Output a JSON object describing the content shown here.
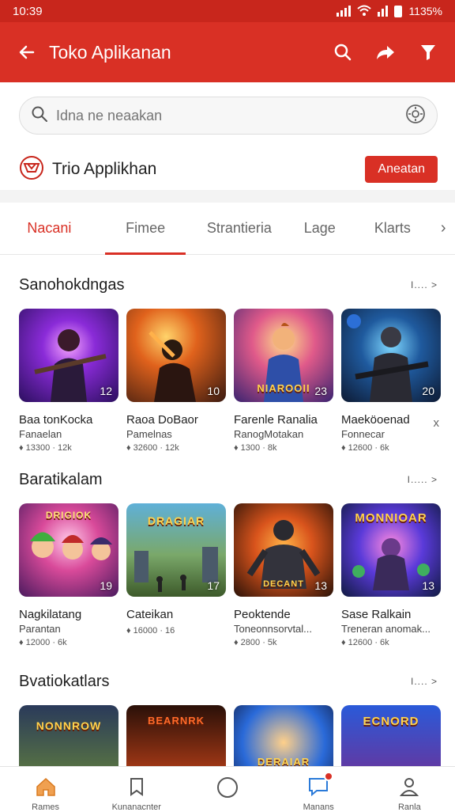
{
  "status": {
    "time": "10:39",
    "battery": "1135%"
  },
  "header": {
    "title": "Toko Aplikanan"
  },
  "search": {
    "placeholder": "Idna ne neaakan"
  },
  "store": {
    "name": "Trio Applikhan",
    "button": "Aneatan"
  },
  "tabs": [
    {
      "label": "Nacani"
    },
    {
      "label": "Fimee"
    },
    {
      "label": "Strantieria"
    },
    {
      "label": "Lage"
    },
    {
      "label": "Klarts"
    }
  ],
  "sections": [
    {
      "title": "Sanohokdngas",
      "more": "I.... >",
      "items": [
        {
          "title": "Baa tonKocka",
          "subtitle": "Fanaelan",
          "meta": "♦ 13300 · 12k",
          "badge": "12"
        },
        {
          "title": "Raoa DoBaor",
          "subtitle": "Pamelnas",
          "meta": "♦ 32600 · 12k",
          "badge": "10"
        },
        {
          "title": "Farenle Ranalia",
          "subtitle": "RanogMotakan",
          "meta": "♦ 1300 · 8k",
          "badge": "23",
          "logo": "NIAROOII"
        },
        {
          "title": "Maeköoenad",
          "subtitle": "Fonnecar",
          "meta": "♦ 12600 · 6k",
          "badge": "20"
        }
      ]
    },
    {
      "title": "Baratikalam",
      "more": "I..... >",
      "items": [
        {
          "title": "Nagkilatang",
          "subtitle": "Parantan",
          "meta": "♦ 12000 · 6k",
          "badge": "19",
          "logo": "DRIGIOK"
        },
        {
          "title": "Cateikan",
          "subtitle": "",
          "meta": "♦ 16000 · 16",
          "badge": "17",
          "logo": "DRAGIAR"
        },
        {
          "title": "Peoktende",
          "subtitle": "Toneonnsorvtal...",
          "meta": "♦ 2800 · 5k",
          "badge": "13",
          "logo": "DECANT"
        },
        {
          "title": "Sase Ralkain",
          "subtitle": "Treneran anomak...",
          "meta": "♦ 12600 · 6k",
          "badge": "13",
          "logo": "MONNIOAR"
        }
      ]
    },
    {
      "title": "Bvatiokatlars",
      "more": "I.... >",
      "items": [
        {
          "logo": "NONNROW"
        },
        {
          "logo": "BEARNRK"
        },
        {
          "logo": "DERAIAR"
        },
        {
          "logo": "ECNORD"
        }
      ]
    }
  ],
  "extra_mark": "x",
  "nav": [
    {
      "label": "Rames",
      "icon": "home-icon"
    },
    {
      "label": "Kunanacnter",
      "icon": "bookmark-icon"
    },
    {
      "label": "",
      "icon": "circle-icon"
    },
    {
      "label": "Manans",
      "icon": "chat-icon"
    },
    {
      "label": "Ranla",
      "icon": "person-icon"
    }
  ],
  "colors": {
    "primary": "#d93025",
    "status_bar": "#c8261c"
  }
}
